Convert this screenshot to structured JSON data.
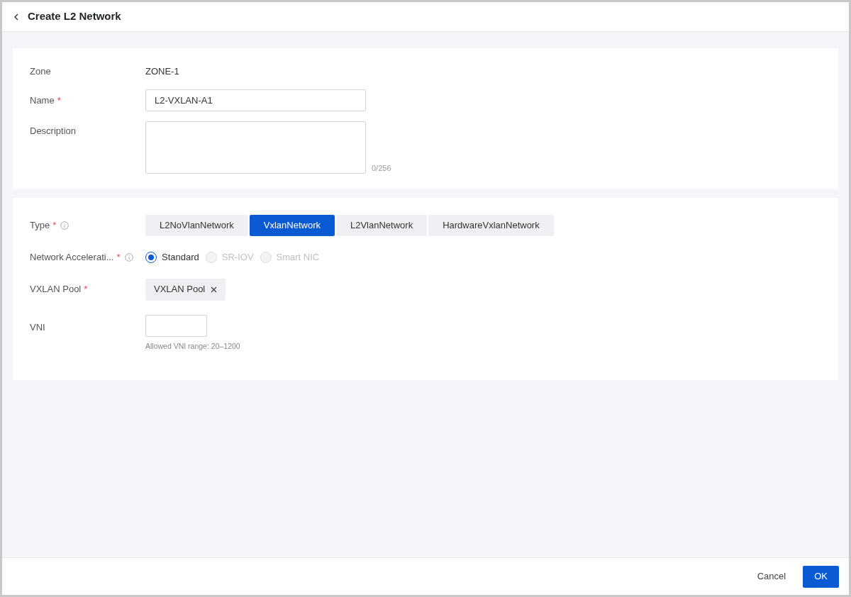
{
  "header": {
    "title": "Create L2 Network"
  },
  "basic": {
    "zone": {
      "label": "Zone",
      "value": "ZONE-1"
    },
    "name": {
      "label": "Name",
      "required": "*",
      "value": "L2-VXLAN-A1"
    },
    "description": {
      "label": "Description",
      "counter": "0/256"
    }
  },
  "config": {
    "type": {
      "label": "Type",
      "required": "*",
      "info": true,
      "options": [
        {
          "label": "L2NoVlanNetwork",
          "selected": false
        },
        {
          "label": "VxlanNetwork",
          "selected": true
        },
        {
          "label": "L2VlanNetwork",
          "selected": false
        },
        {
          "label": "HardwareVxlanNetwork",
          "selected": false
        }
      ]
    },
    "acceleration": {
      "label": "Network Accelerati...",
      "required": "*",
      "info": true,
      "options": [
        {
          "label": "Standard",
          "selected": true,
          "disabled": false
        },
        {
          "label": "SR-IOV",
          "selected": false,
          "disabled": true
        },
        {
          "label": "Smart NIC",
          "selected": false,
          "disabled": true
        }
      ]
    },
    "pool": {
      "label": "VXLAN Pool",
      "required": "*",
      "tag": "VXLAN Pool"
    },
    "vni": {
      "label": "VNI",
      "hint": "Allowed VNI range: 20–1200"
    }
  },
  "footer": {
    "buttons": [
      {
        "label": "Cancel",
        "kind": "secondary"
      },
      {
        "label": "OK",
        "kind": "primary"
      }
    ]
  }
}
